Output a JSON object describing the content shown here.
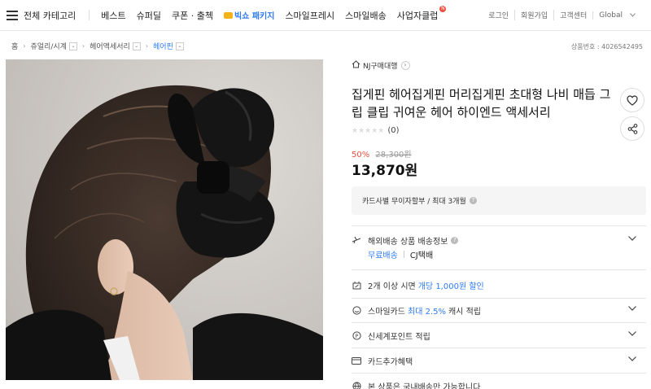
{
  "nav": {
    "all_categories": "전체 카테고리",
    "items": [
      "베스트",
      "슈퍼딜",
      "쿠폰 · 출첵"
    ],
    "promo": "빅쇼 패키지",
    "items2": [
      "스마일프레시",
      "스마일배송",
      "사업자클럽"
    ],
    "badge": "N",
    "util": [
      "로그인",
      "회원가입",
      "고객센터",
      "Global"
    ]
  },
  "breadcrumb": {
    "home": "홈",
    "cat1": "쥬얼리/시계",
    "cat2": "헤어액세서리",
    "cat3": "헤어핀"
  },
  "product_no": "상품번호 : 4026542495",
  "seller": "NJ구매대행",
  "title": "집게핀 헤어집게핀 머리집게핀 초대형 나비 매듭 그립 클립 귀여운 헤어 하이엔드 액세서리",
  "rating": {
    "count": "(0)",
    "stars": 0
  },
  "price": {
    "discount": "50%",
    "original": "28,300원",
    "sale": "13,870원"
  },
  "installment": "카드사별 무이자할부 / 최대 3개월",
  "shipping": {
    "title": "해외배송 상품 배송정보",
    "free": "무료배송",
    "courier": "CJ택배"
  },
  "bulk": {
    "pre": "2개 이상 시면",
    "blue": "개당 1,000원 할인"
  },
  "smilecard": {
    "pre": "스마일카드",
    "blue": "최대 2.5%",
    "post": "캐시 적립"
  },
  "newpoint": "신세계포인트 적립",
  "cardbenefit": "카드추가혜택",
  "domestic": "본 상품은 국내배송만 가능합니다",
  "colors": {
    "accent": "#2f7bf5",
    "discount": "#f04e3e"
  }
}
